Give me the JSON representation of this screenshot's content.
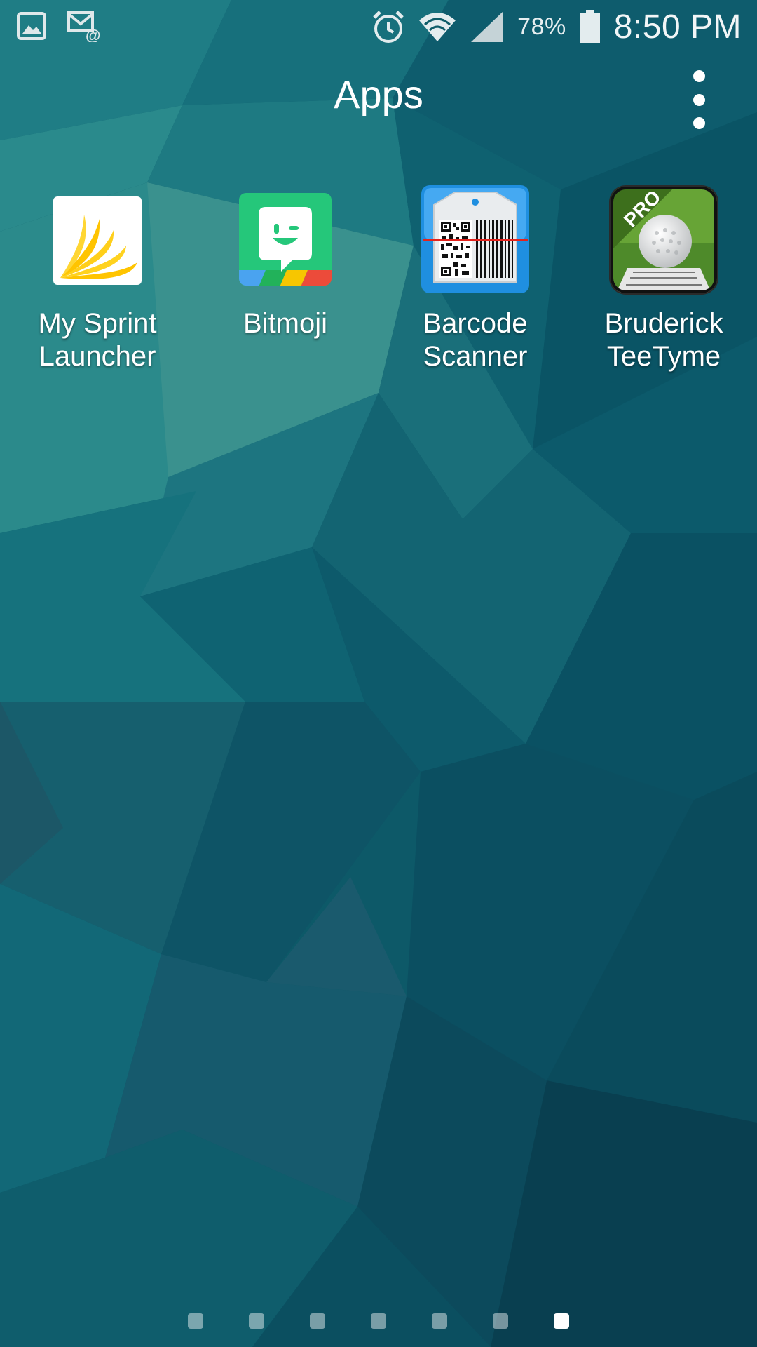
{
  "status_bar": {
    "left_icons": [
      "gallery-notification-icon",
      "email-notification-icon"
    ],
    "right_icons": [
      "alarm-icon",
      "wifi-icon",
      "signal-icon",
      "battery-icon"
    ],
    "battery_percent": "78%",
    "time": "8:50 PM"
  },
  "header": {
    "title": "Apps",
    "menu_icon": "overflow-menu-icon"
  },
  "apps": [
    {
      "label_line1": "My Sprint",
      "label_line2": "Launcher",
      "icon": "sprint-logo-icon"
    },
    {
      "label_line1": "Bitmoji",
      "label_line2": "",
      "icon": "bitmoji-icon"
    },
    {
      "label_line1": "Barcode",
      "label_line2": "Scanner",
      "icon": "barcode-scanner-icon"
    },
    {
      "label_line1": "Bruderick",
      "label_line2": "TeeTyme",
      "icon": "golf-ball-icon",
      "badge": "PRO"
    }
  ],
  "page_indicator": {
    "count": 7,
    "active_index": 6
  },
  "colors": {
    "wallpaper_base": "#0c5866",
    "sprint_yellow": "#ffcc00",
    "bitmoji_green": "#25c77a"
  }
}
